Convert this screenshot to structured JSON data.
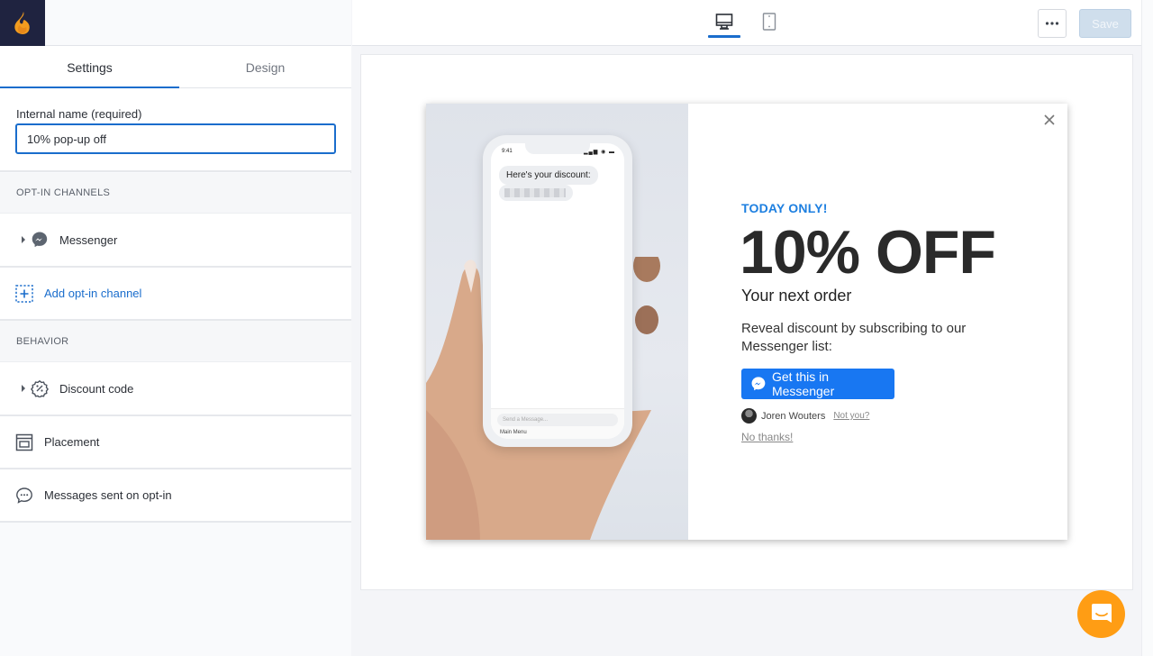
{
  "app": {
    "logo": "flame-logo"
  },
  "tabs": [
    {
      "label": "Settings",
      "active": true
    },
    {
      "label": "Design",
      "active": false
    }
  ],
  "settings": {
    "internal_name_label": "Internal name (required)",
    "internal_name_value": "10% pop-up off",
    "opt_in_section": "OPT-IN CHANNELS",
    "opt_in_items": [
      {
        "label": "Messenger",
        "icon": "messenger-icon",
        "expandable": true
      }
    ],
    "add_channel_label": "Add opt-in channel",
    "behavior_section": "BEHAVIOR",
    "behavior_items": [
      {
        "label": "Discount code",
        "icon": "discount-badge-icon",
        "expandable": true
      },
      {
        "label": "Placement",
        "icon": "placement-icon",
        "expandable": false
      },
      {
        "label": "Messages sent on opt-in",
        "icon": "chat-bubble-icon",
        "expandable": false
      }
    ]
  },
  "toolbar": {
    "devices": [
      {
        "name": "desktop",
        "active": true
      },
      {
        "name": "mobile",
        "active": false
      }
    ],
    "more_label": "•••",
    "save_label": "Save",
    "save_enabled": false
  },
  "popup": {
    "phone": {
      "time": "9:41",
      "status": "▂▄▆ ◉ ▬",
      "message": "Here's your discount:",
      "compose_placeholder": "Send a Message...",
      "menu": "Main Menu"
    },
    "eyebrow": "TODAY ONLY!",
    "headline": "10% OFF",
    "subheadline": "Your next order",
    "description": "Reveal discount by subscribing to our Messenger list:",
    "cta_label": "Get this in Messenger",
    "user_name": "Joren Wouters",
    "not_you": "Not you?",
    "decline": "No thanks!"
  },
  "colors": {
    "accent": "#1a6dcc",
    "messenger_blue": "#1877f2",
    "eyebrow_blue": "#1d7fe0",
    "launcher_orange": "#ff9d14",
    "logo_bg": "#1f2340"
  }
}
